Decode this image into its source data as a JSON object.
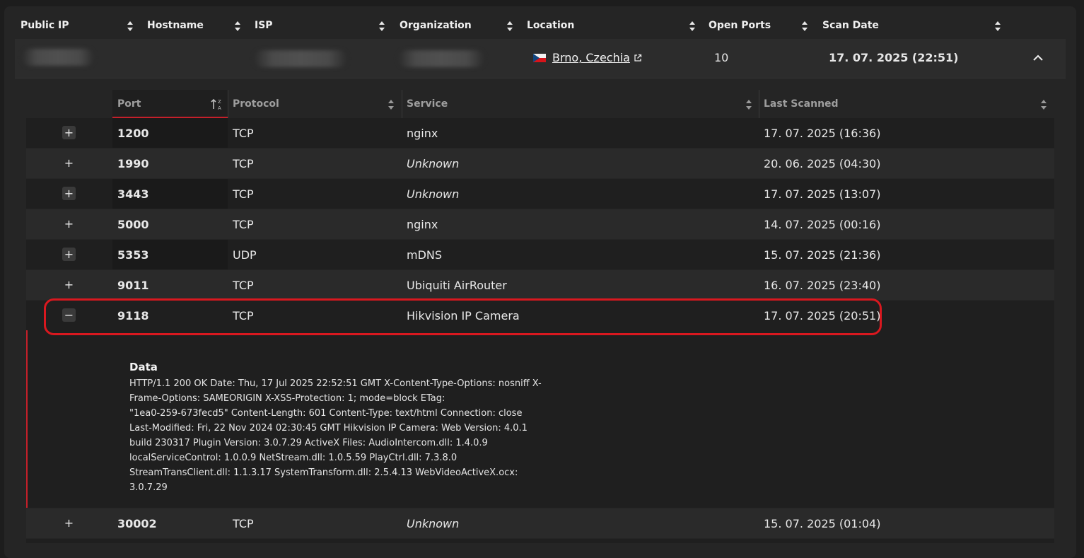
{
  "main_table": {
    "headers": [
      "Public IP",
      "Hostname",
      "ISP",
      "Organization",
      "Location",
      "Open Ports",
      "Scan Date"
    ],
    "host": {
      "location": "Brno, Czechia",
      "open_ports": "10",
      "scan_date": "17. 07. 2025 (22:51)"
    }
  },
  "ports_table": {
    "headers": [
      "Port",
      "Protocol",
      "Service",
      "Last Scanned"
    ],
    "rows": [
      {
        "toggle": "+",
        "port": "1200",
        "protocol": "TCP",
        "service": "nginx",
        "last_scanned": "17. 07. 2025 (16:36)"
      },
      {
        "toggle": "+",
        "port": "1990",
        "protocol": "TCP",
        "service": "Unknown",
        "last_scanned": "20. 06. 2025 (04:30)"
      },
      {
        "toggle": "+",
        "port": "3443",
        "protocol": "TCP",
        "service": "Unknown",
        "last_scanned": "17. 07. 2025 (13:07)"
      },
      {
        "toggle": "+",
        "port": "5000",
        "protocol": "TCP",
        "service": "nginx",
        "last_scanned": "14. 07. 2025 (00:16)"
      },
      {
        "toggle": "+",
        "port": "5353",
        "protocol": "UDP",
        "service": "mDNS",
        "last_scanned": "15. 07. 2025 (21:36)"
      },
      {
        "toggle": "+",
        "port": "9011",
        "protocol": "TCP",
        "service": "Ubiquiti AirRouter",
        "last_scanned": "16. 07. 2025 (23:40)"
      },
      {
        "toggle": "−",
        "port": "9118",
        "protocol": "TCP",
        "service": "Hikvision IP Camera",
        "last_scanned": "17. 07. 2025 (20:51)"
      },
      {
        "toggle": "+",
        "port": "30002",
        "protocol": "TCP",
        "service": "Unknown",
        "last_scanned": "15. 07. 2025 (01:04)"
      }
    ],
    "expanded": {
      "title": "Data",
      "lines": [
        "HTTP/1.1 200 OK Date: Thu, 17 Jul 2025 22:52:51 GMT X-Content-Type-Options: nosniff X-",
        "Frame-Options: SAMEORIGIN X-XSS-Protection: 1; mode=block ETag:",
        "\"1ea0-259-673fecd5\" Content-Length: 601 Content-Type: text/html Connection: close",
        "Last-Modified: Fri, 22 Nov 2024 02:30:45 GMT  Hikvision IP Camera: Web Version: 4.0.1",
        "build 230317 Plugin Version: 3.0.7.29 ActiveX Files: AudioIntercom.dll: 1.4.0.9",
        "localServiceControl: 1.0.0.9 NetStream.dll: 1.0.5.59 PlayCtrl.dll: 7.3.8.0",
        "StreamTransClient.dll: 1.1.3.17 SystemTransform.dll: 2.5.4.13 WebVideoActiveX.ocx: 3.0.7.29"
      ]
    }
  },
  "colors": {
    "accent": "#c4202a",
    "highlight": "#d9181f",
    "background": "#1d1d1d"
  },
  "icons": [
    "sort-icon",
    "external-link-icon",
    "chevron-up-icon",
    "sort-ascending-icon",
    "flag-czechia-icon"
  ]
}
